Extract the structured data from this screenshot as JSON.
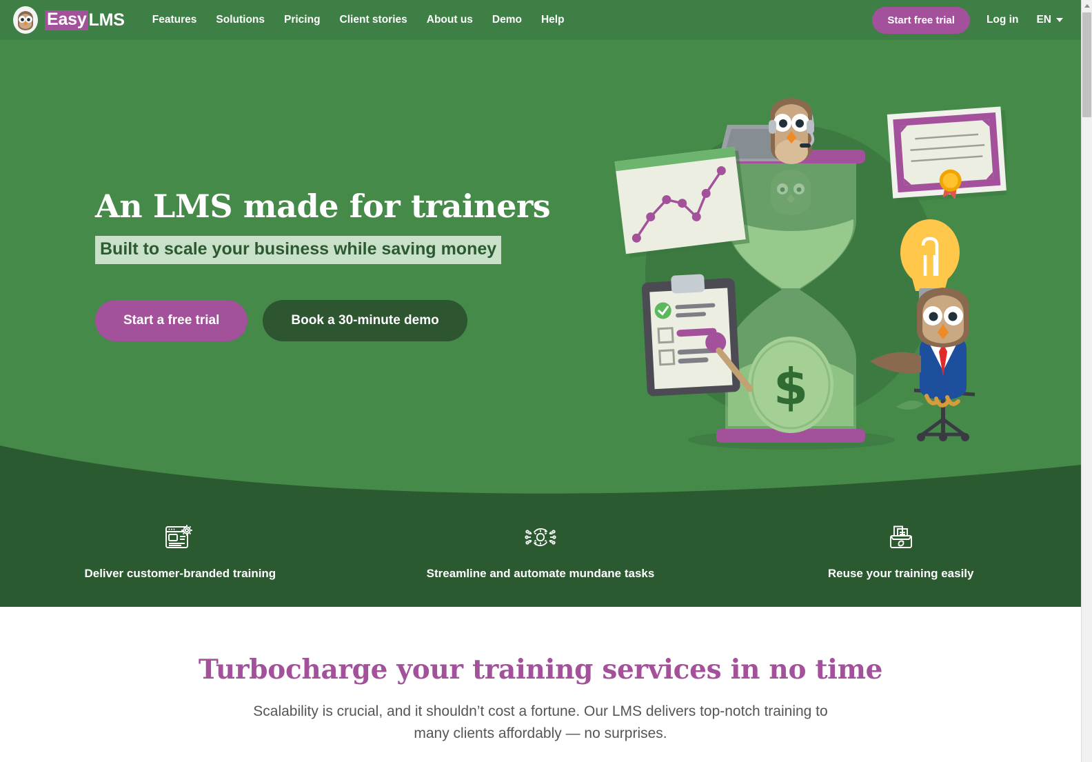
{
  "navbar": {
    "brand": {
      "easy": "Easy",
      "lms": "LMS",
      "logo_icon": "owl-logo-icon"
    },
    "links": [
      {
        "label": "Features"
      },
      {
        "label": "Solutions"
      },
      {
        "label": "Pricing"
      },
      {
        "label": "Client stories"
      },
      {
        "label": "About us"
      },
      {
        "label": "Demo"
      },
      {
        "label": "Help"
      }
    ],
    "trial_button": "Start free trial",
    "login_link": "Log in",
    "language": "EN",
    "language_caret_icon": "chevron-down-icon"
  },
  "hero": {
    "title": "An LMS made for trainers",
    "subtitle": "Built to scale your business while saving money",
    "primary_button": "Start a free trial",
    "secondary_button": "Book a 30-minute demo",
    "illustration_name": "hourglass-owls-illustration"
  },
  "band": {
    "items": [
      {
        "label": "Deliver customer-branded training",
        "icon": "browser-gear-icon"
      },
      {
        "label": "Streamline and automate mundane tasks",
        "icon": "automation-gear-icon"
      },
      {
        "label": "Reuse your training easily",
        "icon": "recycle-documents-icon"
      }
    ]
  },
  "bottom": {
    "title": "Turbocharge your training services in no time",
    "subtitle": "Scalability is crucial, and it shouldn’t cost a fortune. Our LMS delivers top-notch training to many clients affordably — no surprises."
  },
  "colors": {
    "nav_green": "#3d7f45",
    "hero_green": "#458a49",
    "band_green": "#2c5a30",
    "purple": "#a3519b",
    "highlight_mint": "#c9e0c9",
    "dark_button_green": "#2c5530"
  },
  "scrollbar": {
    "name": "vertical-scrollbar"
  }
}
